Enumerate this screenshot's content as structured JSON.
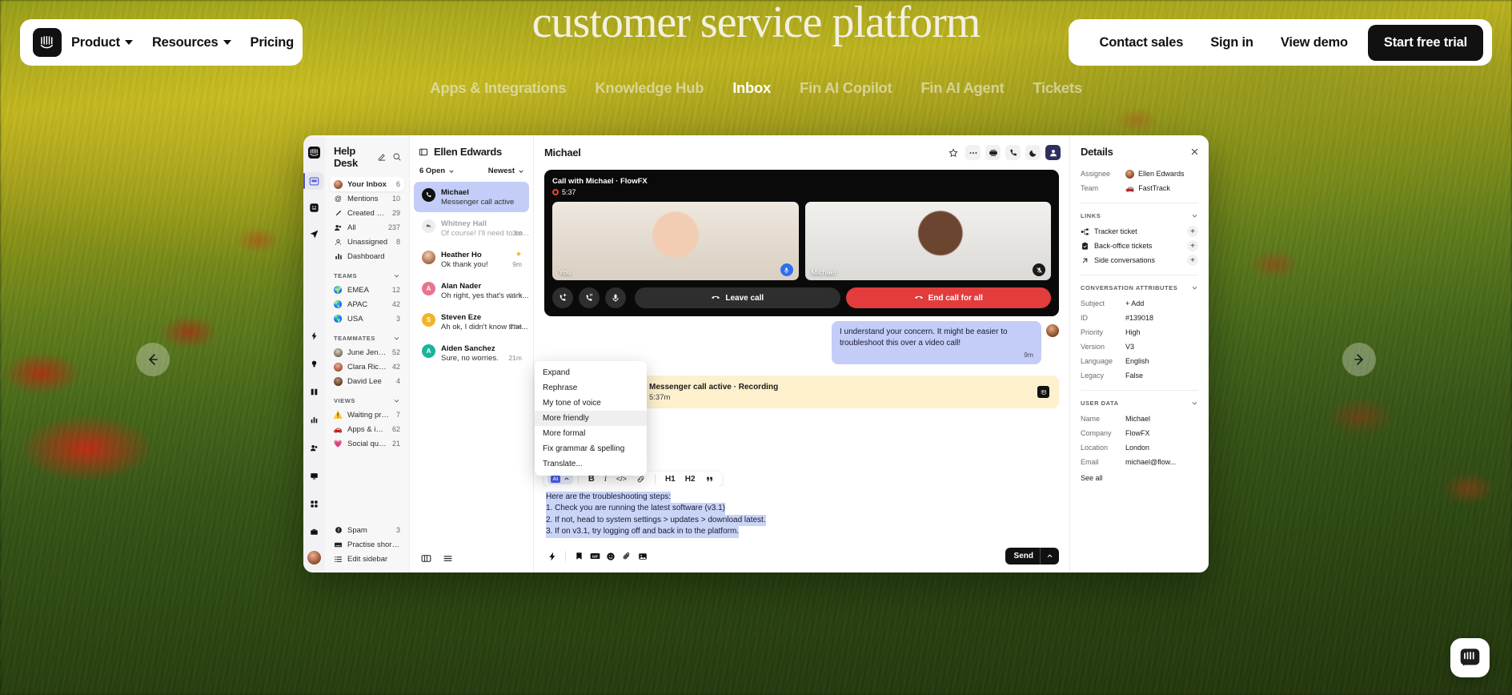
{
  "site": {
    "hero_headline": "customer service platform",
    "nav_left": [
      {
        "label": "Product",
        "has_caret": true
      },
      {
        "label": "Resources",
        "has_caret": true
      },
      {
        "label": "Pricing",
        "has_caret": false
      }
    ],
    "nav_right": [
      {
        "label": "Contact sales"
      },
      {
        "label": "Sign in"
      },
      {
        "label": "View demo"
      }
    ],
    "cta_label": "Start free trial",
    "logo_icon": "intercom-logo-icon",
    "section_tabs": [
      {
        "label": "Apps & Integrations",
        "active": false
      },
      {
        "label": "Knowledge Hub",
        "active": false
      },
      {
        "label": "Inbox",
        "active": true
      },
      {
        "label": "Fin AI Copilot",
        "active": false
      },
      {
        "label": "Fin AI Agent",
        "active": false
      },
      {
        "label": "Tickets",
        "active": false
      }
    ],
    "carousel": {
      "prev_icon": "arrow-left-icon",
      "next_icon": "arrow-right-icon"
    },
    "messenger_fab_icon": "messenger-icon"
  },
  "app": {
    "rail": {
      "logo_icon": "intercom-logo-icon",
      "items": [
        {
          "icon": "inbox-icon",
          "selected": true
        },
        {
          "icon": "messenger-face-icon",
          "selected": false
        },
        {
          "icon": "send-outbound-icon",
          "selected": false
        }
      ],
      "bottom_items": [
        {
          "icon": "lightning-icon"
        },
        {
          "icon": "lightbulb-icon"
        },
        {
          "icon": "book-icon"
        },
        {
          "icon": "bar-chart-icon"
        },
        {
          "icon": "people-icon"
        },
        {
          "icon": "monitor-icon"
        },
        {
          "icon": "grid-icon"
        },
        {
          "icon": "briefcase-icon"
        }
      ],
      "avatar": "user-avatar"
    },
    "sidebar": {
      "title": "Help Desk",
      "compose_icon": "compose-icon",
      "search_icon": "search-icon",
      "items": [
        {
          "icon": "avatar",
          "label": "Your Inbox",
          "count": "6",
          "selected": true
        },
        {
          "icon": "at-icon",
          "label": "Mentions",
          "count": "10",
          "selected": false
        },
        {
          "icon": "pencil-icon",
          "label": "Created by you",
          "count": "29",
          "selected": false
        },
        {
          "icon": "people-icon",
          "label": "All",
          "count": "237",
          "selected": false
        },
        {
          "icon": "unassigned-icon",
          "label": "Unassigned",
          "count": "8",
          "selected": false
        },
        {
          "icon": "bar-chart-icon",
          "label": "Dashboard",
          "count": "",
          "selected": false
        }
      ],
      "teams_header": "TEAMS",
      "teams": [
        {
          "icon": "globe-icon",
          "label": "EMEA",
          "count": "12"
        },
        {
          "icon": "globe-icon",
          "label": "APAC",
          "count": "42"
        },
        {
          "icon": "globe-icon",
          "label": "USA",
          "count": "3"
        }
      ],
      "teammates_header": "TEAMMATES",
      "teammates": [
        {
          "icon": "avatar",
          "label": "June Jenson",
          "count": "52"
        },
        {
          "icon": "avatar",
          "label": "Clara Richards",
          "count": "42"
        },
        {
          "icon": "avatar",
          "label": "David Lee",
          "count": "4"
        }
      ],
      "views_header": "VIEWS",
      "views": [
        {
          "icon": "warning-icon",
          "label": "Waiting premium",
          "count": "7"
        },
        {
          "icon": "car-icon",
          "label": "Apps & integrations",
          "count": "62"
        },
        {
          "icon": "heart-icon",
          "label": "Social queries",
          "count": "21"
        }
      ],
      "footer": [
        {
          "icon": "spam-icon",
          "label": "Spam",
          "count": "3"
        },
        {
          "icon": "keyboard-icon",
          "label": "Practise shortcuts",
          "count": ""
        },
        {
          "icon": "list-icon",
          "label": "Edit sidebar",
          "count": ""
        }
      ]
    },
    "conversation_list": {
      "title": "Ellen Edwards",
      "panel_icon": "panel-toggle-icon",
      "filter_label": "6 Open",
      "sort_label": "Newest",
      "items": [
        {
          "name": "Michael",
          "preview": "Messenger call active",
          "time": "",
          "selected": true,
          "avatar_type": "phone",
          "avatar_color": "#111111",
          "starred": false,
          "muted": false
        },
        {
          "name": "Whitney Hall",
          "preview": "Of course! I'll need to co...",
          "time": "3m",
          "selected": false,
          "avatar_type": "reply",
          "avatar_color": "#ededef",
          "starred": false,
          "muted": true
        },
        {
          "name": "Heather Ho",
          "preview": "Ok thank you!",
          "time": "9m",
          "selected": false,
          "avatar_type": "photo",
          "avatar_color": "#c98a6a",
          "starred": true,
          "muted": false
        },
        {
          "name": "Alan Nader",
          "preview": "Oh right, yes that's work...",
          "time": "11m",
          "selected": false,
          "avatar_type": "initial",
          "avatar_color": "#e8758f",
          "initial": "A",
          "starred": false,
          "muted": false
        },
        {
          "name": "Steven Eze",
          "preview": "Ah ok, I didn't know that...",
          "time": "17m",
          "selected": false,
          "avatar_type": "initial",
          "avatar_color": "#f0b429",
          "initial": "S",
          "starred": false,
          "muted": false
        },
        {
          "name": "Aiden Sanchez",
          "preview": "Sure, no worries.",
          "time": "21m",
          "selected": false,
          "avatar_type": "initial",
          "avatar_color": "#19b59b",
          "initial": "A",
          "starred": false,
          "muted": false
        }
      ],
      "footer_icons": [
        "split-view-icon",
        "list-view-icon"
      ]
    },
    "main": {
      "title": "Michael",
      "header_actions": [
        {
          "icon": "star-icon",
          "plain": true,
          "active": false
        },
        {
          "icon": "more-horizontal-icon",
          "plain": false,
          "active": false
        },
        {
          "icon": "ticket-icon",
          "plain": false,
          "active": false
        },
        {
          "icon": "phone-icon",
          "plain": false,
          "active": false
        },
        {
          "icon": "snooze-moon-icon",
          "plain": false,
          "active": false
        },
        {
          "icon": "person-icon",
          "plain": false,
          "active": true
        }
      ],
      "call": {
        "title": "Call with Michael · FlowFX",
        "duration": "5:37",
        "recording_icon": "record-icon",
        "tiles": [
          {
            "label": "You",
            "mic_icon": "mic-on-icon",
            "mic_state": "on"
          },
          {
            "label": "Michael",
            "mic_icon": "mic-off-icon",
            "mic_state": "off"
          }
        ],
        "buttons": [
          {
            "icon": "add-call-icon",
            "label": ""
          },
          {
            "icon": "hold-call-icon",
            "label": ""
          },
          {
            "icon": "mic-icon",
            "label": ""
          }
        ],
        "leave_label": "Leave call",
        "end_label": "End call for all",
        "leave_icon": "hangup-icon",
        "end_icon": "hangup-icon"
      },
      "messages": [
        {
          "text": "I understand your concern. It might be easier to troubleshoot this over a video call!",
          "time": "9m",
          "side": "right"
        }
      ],
      "call_note": {
        "title": "Messenger call active · Recording",
        "subtitle": "5:37m",
        "icon": "phone-icon",
        "badge_icon": "intercom-logo-icon"
      },
      "ai_menu": [
        {
          "label": "Expand",
          "highlighted": false
        },
        {
          "label": "Rephrase",
          "highlighted": false
        },
        {
          "label": "My tone of voice",
          "highlighted": false
        },
        {
          "label": "More friendly",
          "highlighted": true
        },
        {
          "label": "More formal",
          "highlighted": false
        },
        {
          "label": "Fix grammar & spelling",
          "highlighted": false
        },
        {
          "label": "Translate...",
          "highlighted": false
        }
      ],
      "composer": {
        "ai_chip_label": "AI",
        "ai_chip_caret": "chevron-up-icon",
        "format_buttons": [
          {
            "icon": "bold-icon",
            "label": "B"
          },
          {
            "icon": "italic-icon",
            "label": "i"
          },
          {
            "icon": "code-icon",
            "label": "</>"
          },
          {
            "icon": "link-icon",
            "label": "🔗"
          }
        ],
        "heading_buttons": [
          {
            "icon": "heading-1-icon",
            "label": "H1"
          },
          {
            "icon": "heading-2-icon",
            "label": "H2"
          },
          {
            "icon": "quote-icon",
            "label": "”"
          }
        ],
        "draft_lines": [
          "Here are the troubleshooting steps:",
          "1. Check you are running the latest software (v3.1)",
          "2. If not, head to system settings > updates > download latest.",
          "3. If on v3.1, try logging off and back in to the platform."
        ],
        "bottom_icons": [
          "lightning-icon",
          "saved-reply-icon",
          "gif-icon",
          "emoji-icon",
          "attachment-icon",
          "image-icon"
        ],
        "send_label": "Send",
        "send_caret": "chevron-up-icon"
      }
    },
    "details": {
      "title": "Details",
      "close_icon": "close-icon",
      "top_rows": [
        {
          "key": "Assignee",
          "value": "Ellen Edwards",
          "avatar": true,
          "avatar_color": "#8a4b2a"
        },
        {
          "key": "Team",
          "value": "FastTrack",
          "avatar": false,
          "emoji": "🚗"
        }
      ],
      "links_header": "LINKS",
      "links": [
        {
          "icon": "tracker-icon",
          "label": "Tracker ticket",
          "action": "+"
        },
        {
          "icon": "clipboard-icon",
          "label": "Back-office tickets",
          "action": "+"
        },
        {
          "icon": "arrow-up-right-icon",
          "label": "Side conversations",
          "action": "+"
        }
      ],
      "attributes_header": "CONVERSATION ATTRIBUTES",
      "attributes": [
        {
          "key": "Subject",
          "value": "+ Add"
        },
        {
          "key": "ID",
          "value": "#139018"
        },
        {
          "key": "Priority",
          "value": "High"
        },
        {
          "key": "Version",
          "value": "V3"
        },
        {
          "key": "Language",
          "value": "English"
        },
        {
          "key": "Legacy",
          "value": "False"
        }
      ],
      "userdata_header": "USER DATA",
      "userdata": [
        {
          "key": "Name",
          "value": "Michael"
        },
        {
          "key": "Company",
          "value": "FlowFX"
        },
        {
          "key": "Location",
          "value": "London"
        },
        {
          "key": "Email",
          "value": "michael@flow..."
        }
      ],
      "see_all_label": "See all"
    }
  },
  "colors": {
    "accent_blue": "#c3cdf7",
    "brand_indigo": "#4f5fe8",
    "danger_red": "#e23c3c",
    "note_yellow": "#fdf0cd",
    "dark": "#111111"
  }
}
